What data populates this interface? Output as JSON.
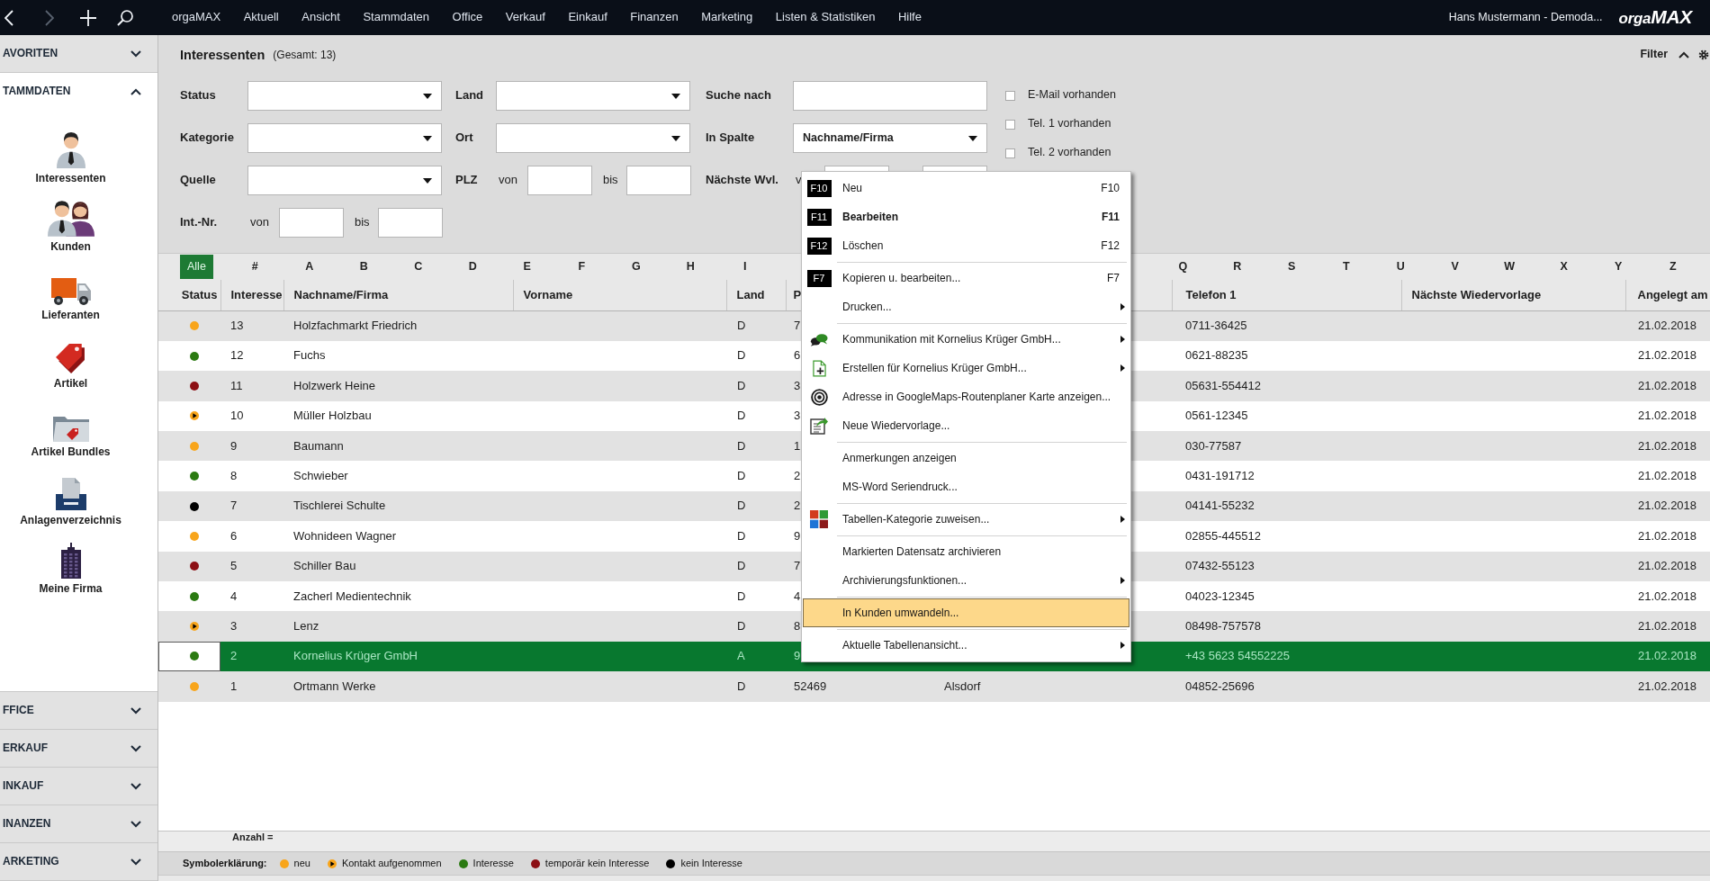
{
  "topbar": {
    "nav": [
      {
        "disabled": false
      },
      {
        "disabled": true
      },
      {
        "disabled": false
      },
      {
        "disabled": false
      }
    ],
    "menu": [
      "orgaMAX",
      "Aktuell",
      "Ansicht",
      "Stammdaten",
      "Office",
      "Verkauf",
      "Einkauf",
      "Finanzen",
      "Marketing",
      "Listen & Statistiken",
      "Hilfe"
    ],
    "user": "Hans Mustermann - Demoda...",
    "logo": "orga**MAX**"
  },
  "sidebar": {
    "sections": [
      {
        "label": "AVORITEN",
        "expanded": false
      },
      {
        "label": "TAMMDATEN",
        "expanded": true,
        "items": [
          "Interessenten",
          "Kunden",
          "Lieferanten",
          "Artikel",
          "Artikel Bundles",
          "Anlagenverzeichnis",
          "Meine Firma"
        ]
      },
      {
        "label": "FFICE",
        "expanded": false
      },
      {
        "label": "ERKAUF",
        "expanded": false
      },
      {
        "label": "INKAUF",
        "expanded": false
      },
      {
        "label": "INANZEN",
        "expanded": false
      },
      {
        "label": "ARKETING",
        "expanded": false
      }
    ]
  },
  "page": {
    "title": "Interessenten",
    "count": "(Gesamt: 13)",
    "filter_toggle": {
      "label": "Filter",
      "expanded": true
    }
  },
  "filters": {
    "rows": [
      [
        {
          "kind": "select",
          "label": "Status"
        },
        {
          "kind": "select",
          "label": "Land"
        },
        {
          "kind": "input",
          "label": "Suche nach"
        }
      ],
      [
        {
          "kind": "select",
          "label": "Kategorie"
        },
        {
          "kind": "select",
          "label": "Ort"
        },
        {
          "kind": "select",
          "label": "In Spalte",
          "value": "Nachname/Firma"
        }
      ],
      [
        {
          "kind": "select",
          "label": "Quelle"
        },
        {
          "kind": "range",
          "label": "PLZ",
          "from": "von",
          "to": "bis"
        },
        {
          "kind": "range",
          "label": "Nächste Wvl.",
          "from": "v"
        }
      ],
      [
        {
          "kind": "range",
          "label": "Int.-Nr.",
          "from": "von",
          "to": "bis"
        }
      ]
    ],
    "checks": [
      {
        "label": "E-Mail vorhanden",
        "checked": false
      },
      {
        "label": "Tel. 1 vorhanden",
        "checked": false
      },
      {
        "label": "Tel. 2 vorhanden",
        "checked": false
      }
    ]
  },
  "letter_filter": {
    "left": [
      {
        "label": "Alle",
        "selected": true
      },
      {
        "label": "#",
        "selected": false
      },
      {
        "label": "A",
        "selected": false
      },
      {
        "label": "B",
        "selected": false
      },
      {
        "label": "C",
        "selected": false
      },
      {
        "label": "D",
        "selected": false
      },
      {
        "label": "E",
        "selected": false
      },
      {
        "label": "F",
        "selected": false
      },
      {
        "label": "G",
        "selected": false
      },
      {
        "label": "H",
        "selected": false
      },
      {
        "label": "I",
        "selected": false
      }
    ],
    "right": [
      {
        "label": "Q",
        "selected": false
      },
      {
        "label": "R",
        "selected": false
      },
      {
        "label": "S",
        "selected": false
      },
      {
        "label": "T",
        "selected": false
      },
      {
        "label": "U",
        "selected": false
      },
      {
        "label": "V",
        "selected": false
      },
      {
        "label": "W",
        "selected": false
      },
      {
        "label": "X",
        "selected": false
      },
      {
        "label": "Y",
        "selected": false
      },
      {
        "label": "Z",
        "selected": false
      }
    ]
  },
  "table": {
    "columns": {
      "status": "Status",
      "interesse": "Interesse",
      "nachname_firma": "Nachname/Firma",
      "vorname": "Vorname",
      "land": "Land",
      "column_6": "P",
      "telefon_1": "Telefon 1",
      "naechste_wiedervorlage": "Nächste Wiedervorlage",
      "angelegt_am": "Angelegt am"
    },
    "rows": [
      {
        "color": "#f8a51b",
        "kind": "solid",
        "selected": false,
        "interesse": "13",
        "nachname_firma": "Holzfachmarkt Friedrich",
        "land": "D",
        "column_6": "7",
        "telefon_1": "0711-36425",
        "angelegt_am": "21.02.2018"
      },
      {
        "color": "#2b7a12",
        "kind": "solid",
        "selected": false,
        "interesse": "12",
        "nachname_firma": "Fuchs",
        "land": "D",
        "column_6": "6",
        "telefon_1": "0621-88235",
        "angelegt_am": "21.02.2018"
      },
      {
        "color": "#8c0f14",
        "kind": "solid",
        "selected": false,
        "interesse": "11",
        "nachname_firma": "Holzwerk Heine",
        "land": "D",
        "column_6": "3",
        "telefon_1": "05631-554412",
        "angelegt_am": "21.02.2018"
      },
      {
        "color": "#f8a51b",
        "kind": "pointer",
        "selected": false,
        "interesse": "10",
        "nachname_firma": "Müller Holzbau",
        "land": "D",
        "column_6": "3",
        "telefon_1": "0561-12345",
        "angelegt_am": "21.02.2018"
      },
      {
        "color": "#f8a51b",
        "kind": "solid",
        "selected": false,
        "interesse": "9",
        "nachname_firma": "Baumann",
        "land": "D",
        "column_6": "1",
        "telefon_1": "030-77587",
        "angelegt_am": "21.02.2018"
      },
      {
        "color": "#2b7a12",
        "kind": "solid",
        "selected": false,
        "interesse": "8",
        "nachname_firma": "Schwieber",
        "land": "D",
        "column_6": "2",
        "telefon_1": "0431-191712",
        "angelegt_am": "21.02.2018"
      },
      {
        "color": "#000000",
        "kind": "solid",
        "selected": false,
        "interesse": "7",
        "nachname_firma": "Tischlerei Schulte",
        "land": "D",
        "column_6": "2",
        "telefon_1": "04141-55232",
        "angelegt_am": "21.02.2018"
      },
      {
        "color": "#f8a51b",
        "kind": "solid",
        "selected": false,
        "interesse": "6",
        "nachname_firma": "Wohnideen Wagner",
        "land": "D",
        "column_6": "9",
        "telefon_1": "02855-445512",
        "angelegt_am": "21.02.2018"
      },
      {
        "color": "#8c0f14",
        "kind": "solid",
        "selected": false,
        "interesse": "5",
        "nachname_firma": "Schiller Bau",
        "land": "D",
        "column_6": "7",
        "telefon_1": "07432-55123",
        "angelegt_am": "21.02.2018"
      },
      {
        "color": "#2b7a12",
        "kind": "solid",
        "selected": false,
        "interesse": "4",
        "nachname_firma": "Zacherl Medientechnik",
        "land": "D",
        "column_6": "4",
        "telefon_1": "04023-12345",
        "angelegt_am": "21.02.2018"
      },
      {
        "color": "#f8a51b",
        "kind": "pointer",
        "selected": false,
        "interesse": "3",
        "nachname_firma": "Lenz",
        "land": "D",
        "column_6": "8",
        "telefon_1": "08498-757578",
        "angelegt_am": "21.02.2018"
      },
      {
        "color": "#2b7a12",
        "kind": "solid",
        "selected": true,
        "interesse": "2",
        "nachname_firma": "Kornelius Krüger GmbH",
        "land": "A",
        "column_6": "9",
        "telefon_1": "+43 5623 54552225",
        "angelegt_am": "21.02.2018"
      },
      {
        "color": "#f8a51b",
        "kind": "solid",
        "selected": false,
        "interesse": "1",
        "nachname_firma": "Ortmann Werke",
        "land": "D",
        "column_6": "52469",
        "column_7": "Alsdorf",
        "telefon_1": "04852-25696",
        "angelegt_am": "21.02.2018"
      }
    ]
  },
  "summary": "Anzahl =",
  "legend": {
    "title": "Symbolerklärung:",
    "items": [
      {
        "color": "#f8a51b",
        "kind": "solid",
        "label": "neu"
      },
      {
        "color": "#f8a51b",
        "kind": "pointer",
        "label": "Kontakt aufgenommen"
      },
      {
        "color": "#2b7a12",
        "kind": "solid",
        "label": "Interesse"
      },
      {
        "color": "#8c0f14",
        "kind": "solid",
        "label": "temporär kein Interesse"
      },
      {
        "color": "#000000",
        "kind": "solid",
        "label": "kein Interesse"
      }
    ]
  },
  "context_menu": {
    "items": [
      {
        "kind": "entry",
        "key": "F10",
        "label": "Neu",
        "shortcut": "F10",
        "default": false,
        "submenu": false,
        "highlighted": false
      },
      {
        "kind": "entry",
        "key": "F11",
        "label": "Bearbeiten",
        "shortcut": "F11",
        "default": true,
        "submenu": false,
        "highlighted": false
      },
      {
        "kind": "entry",
        "key": "F12",
        "label": "Löschen",
        "shortcut": "F12",
        "default": false,
        "submenu": false,
        "highlighted": false
      },
      {
        "kind": "separator"
      },
      {
        "kind": "entry",
        "key": "F7",
        "label": "Kopieren u. bearbeiten...",
        "shortcut": "F7",
        "default": false,
        "submenu": false,
        "highlighted": false
      },
      {
        "kind": "entry",
        "label": "Drucken...",
        "default": false,
        "submenu": true,
        "highlighted": false
      },
      {
        "kind": "separator"
      },
      {
        "kind": "entry",
        "label": "Kommunikation mit Kornelius Krüger GmbH...",
        "default": false,
        "submenu": true,
        "highlighted": false
      },
      {
        "kind": "entry",
        "label": "Erstellen für Kornelius Krüger GmbH...",
        "default": false,
        "submenu": true,
        "highlighted": false
      },
      {
        "kind": "entry",
        "label": "Adresse in GoogleMaps-Routenplaner Karte anzeigen...",
        "default": false,
        "submenu": false,
        "highlighted": false
      },
      {
        "kind": "entry",
        "label": "Neue Wiedervorlage...",
        "default": false,
        "submenu": false,
        "highlighted": false
      },
      {
        "kind": "separator"
      },
      {
        "kind": "entry",
        "label": "Anmerkungen anzeigen",
        "default": false,
        "submenu": false,
        "highlighted": false
      },
      {
        "kind": "entry",
        "label": "MS-Word Seriendruck...",
        "default": false,
        "submenu": false,
        "highlighted": false
      },
      {
        "kind": "separator"
      },
      {
        "kind": "entry",
        "label": "Tabellen-Kategorie zuweisen...",
        "default": false,
        "submenu": true,
        "highlighted": false
      },
      {
        "kind": "separator"
      },
      {
        "kind": "entry",
        "label": "Markierten Datensatz archivieren",
        "default": false,
        "submenu": false,
        "highlighted": false
      },
      {
        "kind": "entry",
        "label": "Archivierungsfunktionen...",
        "default": false,
        "submenu": true,
        "highlighted": false
      },
      {
        "kind": "separator"
      },
      {
        "kind": "entry",
        "label": "In Kunden umwandeln...",
        "default": false,
        "submenu": false,
        "highlighted": true
      },
      {
        "kind": "separator"
      },
      {
        "kind": "entry",
        "label": "Aktuelle Tabellenansicht...",
        "default": false,
        "submenu": true,
        "highlighted": false
      }
    ]
  }
}
